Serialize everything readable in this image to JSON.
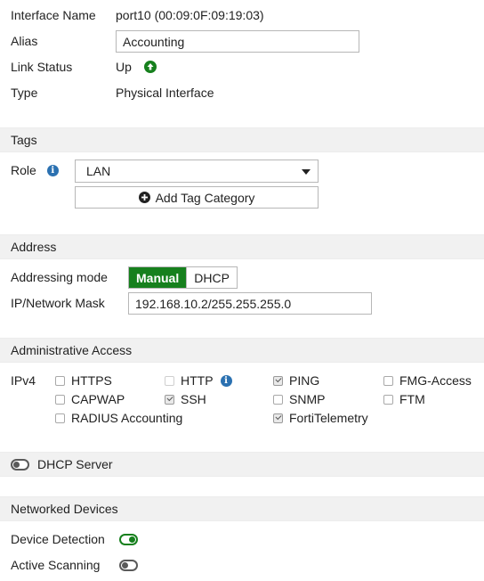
{
  "interface": {
    "interface_name_label": "Interface Name",
    "interface_name_value": "port10 (00:09:0F:09:19:03)",
    "alias_label": "Alias",
    "alias_value": "Accounting",
    "link_status_label": "Link Status",
    "link_status_value": "Up",
    "type_label": "Type",
    "type_value": "Physical Interface"
  },
  "tags": {
    "section_title": "Tags",
    "role_label": "Role",
    "role_value": "LAN",
    "add_tag_category_label": "Add Tag Category"
  },
  "address": {
    "section_title": "Address",
    "addressing_mode_label": "Addressing mode",
    "mode_manual": "Manual",
    "mode_dhcp": "DHCP",
    "ip_mask_label": "IP/Network Mask",
    "ip_mask_value": "192.168.10.2/255.255.255.0"
  },
  "admin_access": {
    "section_title": "Administrative Access",
    "ipv4_label": "IPv4",
    "options": {
      "https": {
        "label": "HTTPS",
        "checked": false
      },
      "http": {
        "label": "HTTP",
        "checked": false
      },
      "ping": {
        "label": "PING",
        "checked": true
      },
      "fmg_access": {
        "label": "FMG-Access",
        "checked": false
      },
      "capwap": {
        "label": "CAPWAP",
        "checked": false
      },
      "ssh": {
        "label": "SSH",
        "checked": true
      },
      "snmp": {
        "label": "SNMP",
        "checked": false
      },
      "ftm": {
        "label": "FTM",
        "checked": false
      },
      "radius_accounting": {
        "label": "RADIUS Accounting",
        "checked": false
      },
      "fortitelemetry": {
        "label": "FortiTelemetry",
        "checked": true
      }
    }
  },
  "dhcp_server": {
    "label": "DHCP Server",
    "enabled": false
  },
  "networked_devices": {
    "section_title": "Networked Devices",
    "device_detection_label": "Device Detection",
    "device_detection_enabled": true,
    "active_scanning_label": "Active Scanning",
    "active_scanning_enabled": false
  },
  "colors": {
    "accent_green": "#16801d",
    "info_blue": "#2b71b1",
    "section_bg": "#f1f1f1"
  },
  "icons": [
    "arrow-up-circle-icon",
    "info-icon",
    "plus-circle-icon",
    "caret-down-icon",
    "toggle-icon"
  ]
}
